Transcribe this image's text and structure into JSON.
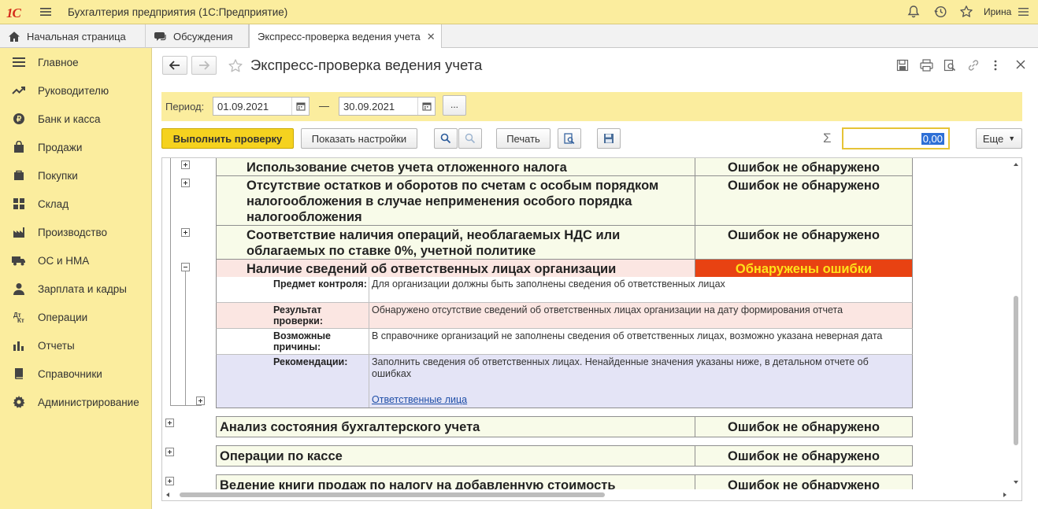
{
  "app": {
    "logo_text": "1С",
    "title": "Бухгалтерия предприятия (1С:Предприятие)",
    "user": "Ирина"
  },
  "tabs": [
    {
      "label": "Начальная страница",
      "icon": "home-icon"
    },
    {
      "label": "Обсуждения",
      "icon": "chat-icon"
    },
    {
      "label": "Экспресс-проверка ведения учета",
      "icon": "",
      "close": "✕"
    }
  ],
  "sidebar": {
    "items": [
      {
        "label": "Главное",
        "icon": "menu-icon"
      },
      {
        "label": "Руководителю",
        "icon": "trend-icon"
      },
      {
        "label": "Банк и касса",
        "icon": "coin-icon"
      },
      {
        "label": "Продажи",
        "icon": "bag-icon"
      },
      {
        "label": "Покупки",
        "icon": "cart-icon"
      },
      {
        "label": "Склад",
        "icon": "grid-icon"
      },
      {
        "label": "Производство",
        "icon": "factory-icon"
      },
      {
        "label": "ОС и НМА",
        "icon": "truck-icon"
      },
      {
        "label": "Зарплата и кадры",
        "icon": "person-icon"
      },
      {
        "label": "Операции",
        "icon": "operations-icon"
      },
      {
        "label": "Отчеты",
        "icon": "bars-icon"
      },
      {
        "label": "Справочники",
        "icon": "book-icon"
      },
      {
        "label": "Администрирование",
        "icon": "gear-icon"
      }
    ]
  },
  "page": {
    "title": "Экспресс-проверка ведения учета",
    "period_label": "Период:",
    "date_from": "01.09.2021",
    "date_to": "30.09.2021",
    "dash": "—",
    "more_dots": "..."
  },
  "toolbar": {
    "run_label": "Выполнить проверку",
    "settings_label": "Показать настройки",
    "print_label": "Печать",
    "sigma": "Σ",
    "sum_value": "0,00",
    "more_label": "Еще"
  },
  "report": {
    "rows": [
      {
        "name": "Использование счетов учета отложенного налога",
        "status": "Ошибок не обнаружено"
      },
      {
        "name": "Отсутствие остатков и оборотов по счетам с особым порядком налогообложения в случае неприменения особого порядка налогообложения",
        "status": "Ошибок не обнаружено"
      },
      {
        "name": "Соответствие наличия операций, необлагаемых НДС или облагаемых по ставке 0%, учетной политике",
        "status": "Ошибок не обнаружено"
      },
      {
        "name": "Наличие сведений об ответственных лицах организации",
        "status": "Обнаружены ошибки"
      }
    ],
    "details": {
      "subject_label": "Предмет контроля:",
      "subject_value": "Для организации должны быть заполнены сведения об ответственных лицах",
      "result_label": "Результат проверки:",
      "result_value": "Обнаружено отсутствие сведений об ответственных лицах организации на дату формирования отчета",
      "causes_label": "Возможные причины:",
      "causes_value": "В справочнике организаций не заполнены сведения об ответственных лицах, возможно указана неверная дата",
      "recs_label": "Рекомендации:",
      "recs_value": "Заполнить сведения об ответственных лицах. Ненайденные значения указаны ниже, в детальном отчете об ошибках",
      "recs_link": "Ответственные лица"
    },
    "groups": [
      {
        "name": "Анализ состояния бухгалтерского учета",
        "status": "Ошибок не обнаружено"
      },
      {
        "name": "Операции по кассе",
        "status": "Ошибок не обнаружено"
      },
      {
        "name": "Ведение книги продаж по налогу на добавленную стоимость",
        "status": "Ошибок не обнаружено"
      }
    ]
  },
  "colors": {
    "sidebar_bg": "#fbed9e",
    "row_ok_bg": "#f8fbe9",
    "row_error_bg": "#fbe6e2",
    "error_badge_bg": "#e84212",
    "error_badge_text": "#ffe21a",
    "recs_bg": "#e4e4f6",
    "run_button": "#f5d21f"
  }
}
